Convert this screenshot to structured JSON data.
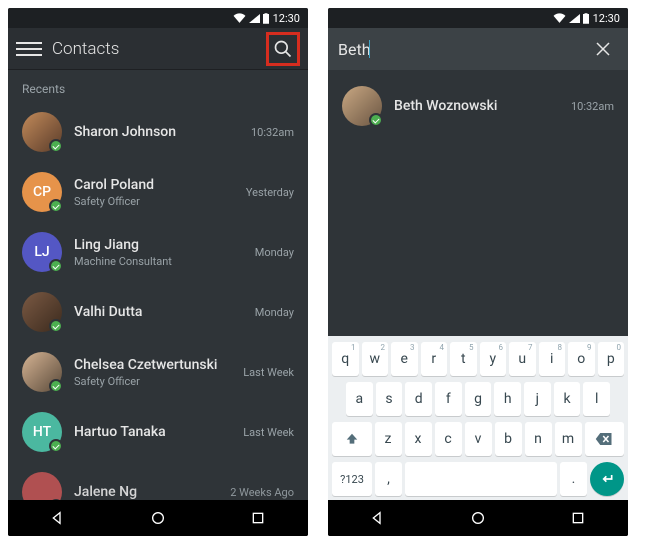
{
  "statusbar": {
    "time": "12:30"
  },
  "left": {
    "title": "Contacts",
    "section_header": "Recents",
    "contacts": [
      {
        "name": "Sharon Johnson",
        "subtitle": "",
        "time": "10:32am",
        "initials": ""
      },
      {
        "name": "Carol Poland",
        "subtitle": "Safety Officer",
        "time": "Yesterday",
        "initials": "CP"
      },
      {
        "name": "Ling Jiang",
        "subtitle": "Machine Consultant",
        "time": "Monday",
        "initials": "LJ"
      },
      {
        "name": "Valhi Dutta",
        "subtitle": "",
        "time": "Monday",
        "initials": ""
      },
      {
        "name": "Chelsea Czetwertunski",
        "subtitle": "Safety Officer",
        "time": "Last Week",
        "initials": ""
      },
      {
        "name": "Hartuo Tanaka",
        "subtitle": "",
        "time": "Last Week",
        "initials": "HT"
      },
      {
        "name": "Jalene Ng",
        "subtitle": "",
        "time": "2 Weeks Ago",
        "initials": ""
      }
    ]
  },
  "right": {
    "search_value": "Beth",
    "result": {
      "name": "Beth Woznowski",
      "time": "10:32am"
    },
    "keyboard": {
      "row1": [
        "q",
        "w",
        "e",
        "r",
        "t",
        "y",
        "u",
        "i",
        "o",
        "p"
      ],
      "row1_nums": [
        "1",
        "2",
        "3",
        "4",
        "5",
        "6",
        "7",
        "8",
        "9",
        "0"
      ],
      "row2": [
        "a",
        "s",
        "d",
        "f",
        "g",
        "h",
        "j",
        "k",
        "l"
      ],
      "row3_mid": [
        "z",
        "x",
        "c",
        "v",
        "b",
        "n",
        "m"
      ],
      "sym": "?123",
      "comma": ",",
      "period": "."
    }
  }
}
